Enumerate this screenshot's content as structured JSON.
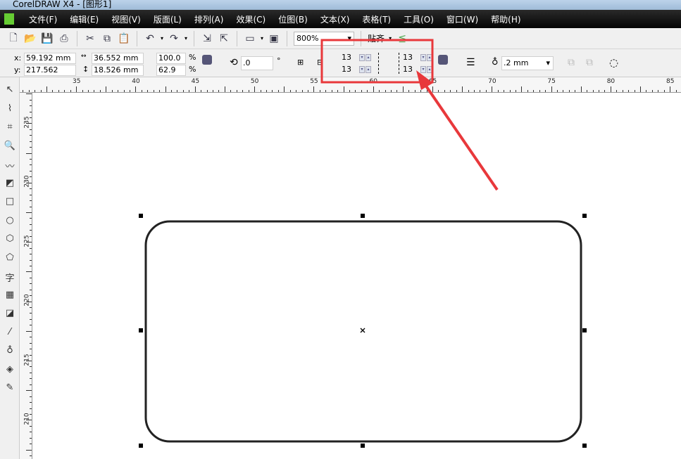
{
  "window": {
    "title": "CorelDRAW X4 - [图形1]"
  },
  "menu": [
    "文件(F)",
    "编辑(E)",
    "视图(V)",
    "版面(L)",
    "排列(A)",
    "效果(C)",
    "位图(B)",
    "文本(X)",
    "表格(T)",
    "工具(O)",
    "窗口(W)",
    "帮助(H)"
  ],
  "toolbar": {
    "zoom": "800%",
    "snap": "贴齐"
  },
  "property_bar": {
    "x_label": "x:",
    "x": "59.192 mm",
    "y_label": "y:",
    "y": "217.562 mm",
    "width": "36.552 mm",
    "height": "18.526 mm",
    "scale_x": "100.0",
    "scale_y": "62.9",
    "percent": "%",
    "rotation": ".0",
    "degree": "°",
    "corner_tl": "13",
    "corner_bl": "13",
    "corner_tr": "13",
    "corner_br": "13",
    "outline_width": ".2 mm"
  },
  "rulers": {
    "horizontal": [
      "35",
      "40",
      "45",
      "50",
      "55",
      "60",
      "65",
      "70",
      "75",
      "80",
      "85"
    ],
    "vertical": [
      "235",
      "230",
      "225",
      "220",
      "215",
      "210"
    ]
  },
  "annotation": {
    "color": "#e8383b"
  },
  "tools": [
    "pick-tool",
    "shape-tool",
    "crop-tool",
    "zoom-tool",
    "freehand-tool",
    "smart-fill-tool",
    "rectangle-tool",
    "ellipse-tool",
    "polygon-tool",
    "basic-shapes-tool",
    "text-tool",
    "table-tool",
    "interactive-tool",
    "eyedropper-tool",
    "outline-tool",
    "fill-tool",
    "interactive-fill-tool"
  ],
  "text_tool_glyph": "字"
}
